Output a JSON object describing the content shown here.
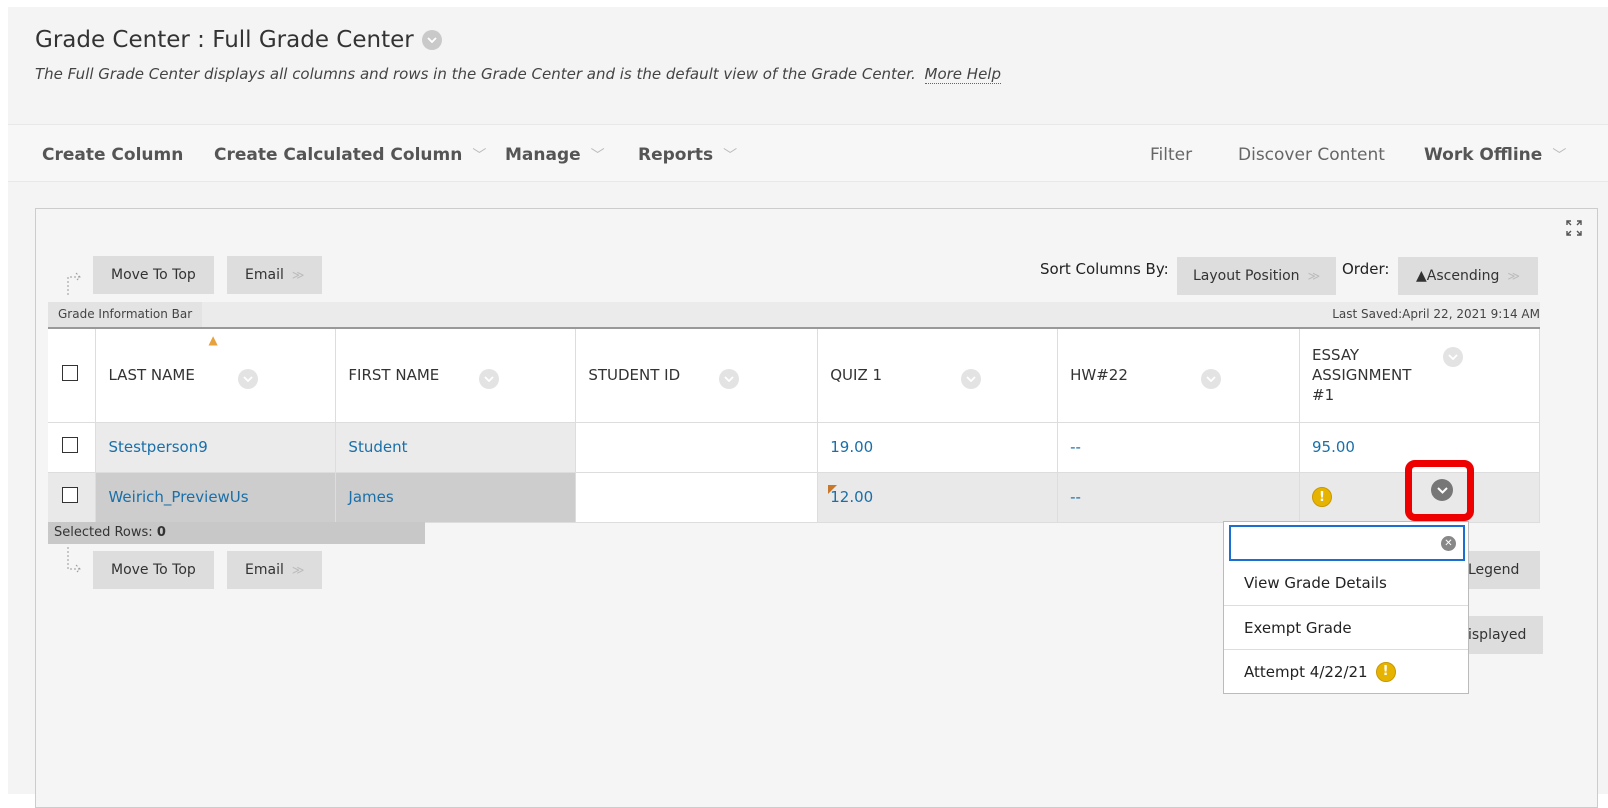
{
  "header": {
    "title": "Grade Center : Full Grade Center",
    "description": "The Full Grade Center displays all columns and rows in the Grade Center and is the default view of the Grade Center.",
    "more_help": "More Help"
  },
  "toolbar": {
    "create_column": "Create Column",
    "create_calculated_column": "Create Calculated Column",
    "manage": "Manage",
    "reports": "Reports",
    "filter": "Filter",
    "discover_content": "Discover Content",
    "work_offline": "Work Offline"
  },
  "actions": {
    "move_to_top": "Move To Top",
    "email": "Email",
    "sort_columns_by_label": "Sort Columns By:",
    "sort_columns_by_value": "Layout Position",
    "order_label": "Order:",
    "order_value": "▲Ascending"
  },
  "info_bar": {
    "label": "Grade Information Bar",
    "last_saved": "Last Saved:April 22, 2021 9:14 AM"
  },
  "columns": {
    "last_name": "LAST NAME",
    "first_name": "FIRST NAME",
    "student_id": "STUDENT ID",
    "quiz1": "QUIZ 1",
    "hw22": "HW#22",
    "essay_line1": "ESSAY",
    "essay_line2": "ASSIGNMENT",
    "essay_line3": "#1"
  },
  "rows": [
    {
      "last_name": "Stestperson9",
      "first_name": "Student",
      "student_id": "",
      "quiz1": "19.00",
      "hw22": "--",
      "essay": "95.00"
    },
    {
      "last_name": "Weirich_PreviewUs",
      "first_name": "James",
      "student_id": "",
      "quiz1": "12.00",
      "hw22": "--",
      "essay": ""
    }
  ],
  "selected_rows": {
    "label": "Selected Rows:",
    "count": "0"
  },
  "side_buttons": {
    "legend": "Legend",
    "displayed": "isplayed"
  },
  "popup_menu": {
    "search_value": "",
    "items": [
      "View Grade Details",
      "Exempt Grade",
      "Attempt 4/22/21"
    ]
  },
  "colors": {
    "link": "#1a6fa8",
    "highlight": "#ee0000",
    "warning": "#e6b400",
    "focus": "#1a6fd1"
  }
}
